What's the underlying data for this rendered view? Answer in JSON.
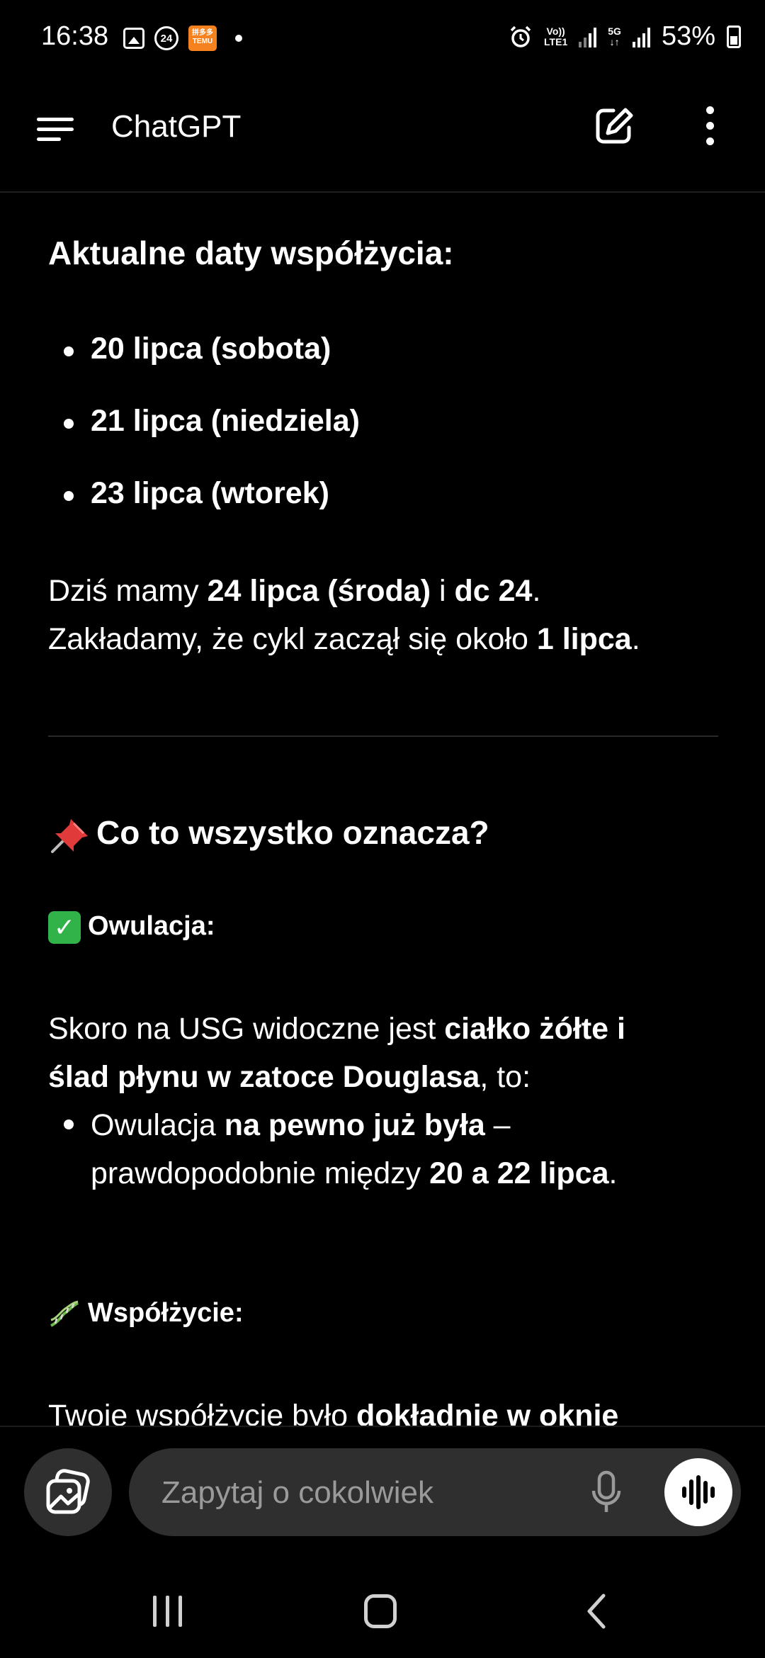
{
  "status_bar": {
    "time": "16:38",
    "badge_24": "24",
    "temu_line1": "拼多多",
    "temu_line2": "TEMU",
    "volte_top": "Vo))",
    "volte_bottom": "LTE1",
    "fiveg_top": "5G",
    "fiveg_bottom": "↓↑",
    "battery": "53%"
  },
  "app_bar": {
    "title": "ChatGPT",
    "icons": [
      "menu-icon",
      "new-chat-icon",
      "more-vert-icon"
    ]
  },
  "message": {
    "heading_dates": "Aktualne daty współżycia:",
    "dates": [
      "20 lipca (sobota)",
      "21 lipca (niedziela)",
      "23 lipca (wtorek)"
    ],
    "today_p1": "Dziś mamy ",
    "today_b1": "24 lipca (środa)",
    "today_p2": " i ",
    "today_b2": "dc 24",
    "today_p3": ".",
    "cycle_p1": "Zakładamy, że cykl zaczął się około ",
    "cycle_b1": "1 lipca",
    "cycle_p2": ".",
    "section_heading": "Co to wszystko oznacza?",
    "ovulation_heading": "Owulacja:",
    "usg_p1": "Skoro na USG widoczne jest ",
    "usg_b1": "ciałko żółte i",
    "usg_b2": "ślad płynu w zatoce Douglasa",
    "usg_p2": ", to:",
    "ov_p1": "Owulacja ",
    "ov_b1": "na pewno już była",
    "ov_p2": " –",
    "ov_p3": "prawdopodobnie między ",
    "ov_b2": "20 a 22 lipca",
    "ov_p4": ".",
    "intercourse_heading": "Współżycie:",
    "cut_p1": "Twoje współżycie było ",
    "cut_b1": "dokładnie w oknie"
  },
  "composer": {
    "placeholder": "Zapytaj o cokolwiek"
  },
  "colors": {
    "background": "#000000",
    "input_bg": "#2f2f2f",
    "check_green": "#32b34a"
  }
}
